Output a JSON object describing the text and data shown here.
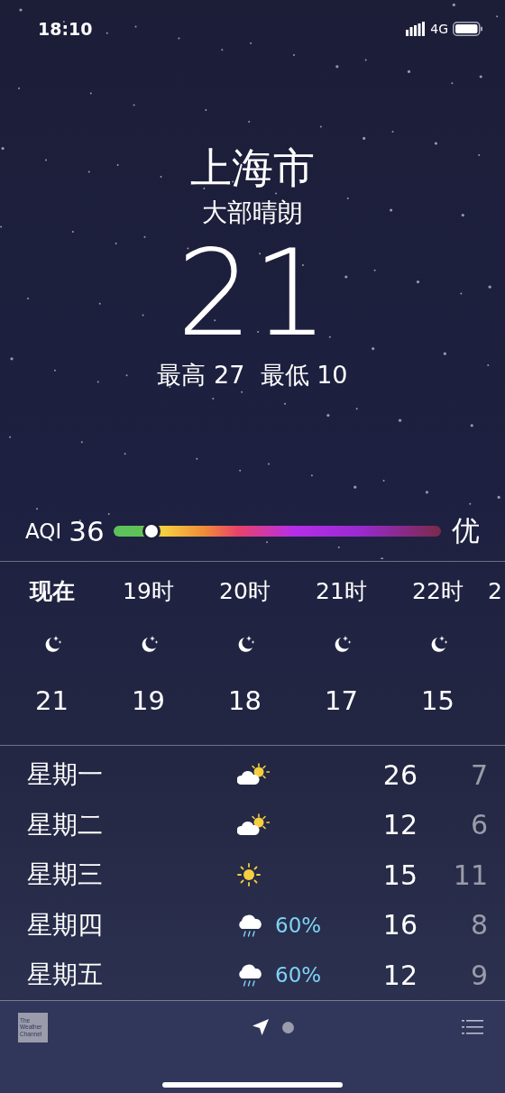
{
  "status_bar": {
    "time": "18:10",
    "network": "4G"
  },
  "location": {
    "city": "上海市",
    "condition": "大部晴朗",
    "temperature": "21",
    "high_low": "最高 27  最低 10"
  },
  "aqi": {
    "label": "AQI",
    "value": "36",
    "level": 0.107,
    "rating": "优"
  },
  "hourly": [
    {
      "label": "现在",
      "now": true,
      "kind": "moon",
      "temp": "21"
    },
    {
      "label": "19时",
      "now": false,
      "kind": "moon",
      "temp": "19"
    },
    {
      "label": "20时",
      "now": false,
      "kind": "moon",
      "temp": "18"
    },
    {
      "label": "21时",
      "now": false,
      "kind": "moon",
      "temp": "17"
    },
    {
      "label": "22时",
      "now": false,
      "kind": "moon",
      "temp": "15"
    },
    {
      "label": "2",
      "now": false
    }
  ],
  "daily": [
    {
      "day": "星期一",
      "kind": "partly_cloudy",
      "high": "26",
      "low": "7"
    },
    {
      "day": "星期二",
      "kind": "partly_cloudy",
      "high": "12",
      "low": "6"
    },
    {
      "day": "星期三",
      "kind": "sunny",
      "high": "15",
      "low": "11"
    },
    {
      "day": "星期四",
      "kind": "rain",
      "precip": "60%",
      "high": "16",
      "low": "8"
    },
    {
      "day": "星期五",
      "kind": "rain",
      "precip": "60%",
      "high": "12",
      "low": "9"
    }
  ],
  "bottom_bar": {
    "logo_text": "The Weather Channel",
    "pages": [
      {
        "kind": "location",
        "selected": true
      },
      {
        "kind": "dot",
        "selected": false
      }
    ]
  }
}
